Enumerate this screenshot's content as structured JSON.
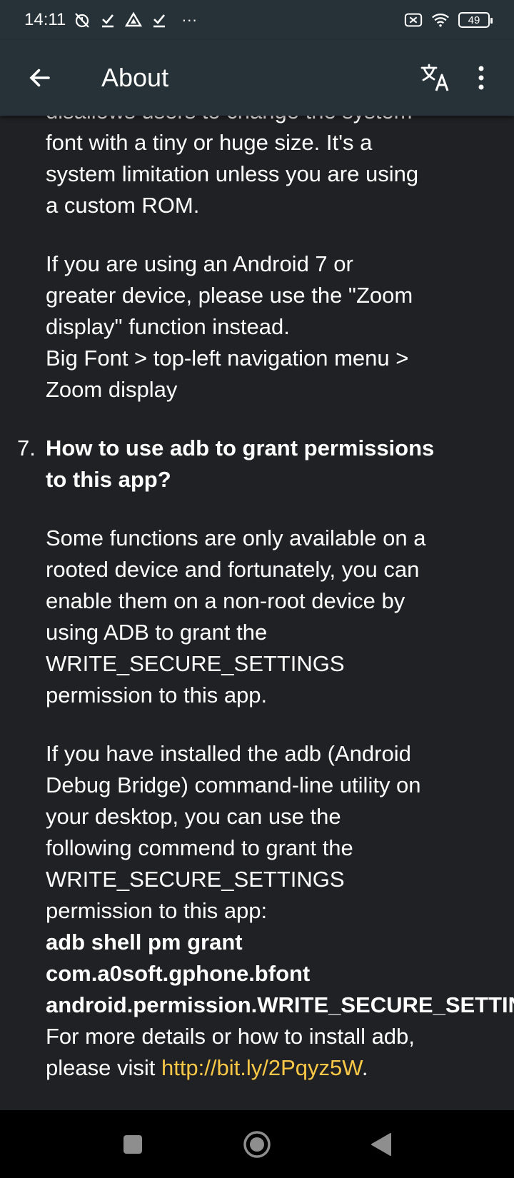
{
  "status_bar": {
    "time": "14:11",
    "more": "···",
    "battery": "49"
  },
  "app_bar": {
    "title": "About"
  },
  "content": {
    "partial_top_line": "disallows users to change the system",
    "p1_lines": [
      "font with a tiny or huge size. It's a",
      "system limitation unless you are using",
      "a custom ROM."
    ],
    "p2_lines": [
      "If you are using an Android 7 or",
      "greater device, please use the \"Zoom",
      "display\" function instead.",
      "Big Font > top-left navigation menu >",
      "Zoom display"
    ],
    "question": {
      "number": "7.",
      "lines": [
        "How to use adb to grant permissions",
        "to this app?"
      ]
    },
    "p3_lines": [
      "Some functions are only available on a",
      "rooted device and fortunately, you can",
      "enable them on a non-root device by",
      "using ADB to grant the",
      "WRITE_SECURE_SETTINGS",
      "permission to this app."
    ],
    "p4_lines": [
      "If you have installed the adb (Android",
      "Debug Bridge) command-line utility on",
      "your desktop, you can use the",
      "following commend to grant the",
      "WRITE_SECURE_SETTINGS",
      "permission to this app:"
    ],
    "command_lines": [
      "adb shell pm grant",
      "com.a0soft.gphone.bfont",
      "android.permission.WRITE_SECURE_SETTINGS"
    ],
    "details_line": "For more details or how to install adb,",
    "visit_prefix": "please visit ",
    "link_text": "http://bit.ly/2Pqyz5W",
    "visit_suffix": "."
  },
  "colors": {
    "app_bar_bg": "#263238",
    "content_bg": "#202124",
    "link": "#f9c846",
    "nav_bg": "#000000"
  },
  "icons": {
    "back": "arrow-left-icon",
    "translate": "translate-icon",
    "overflow": "more-vert-icon",
    "nav_recents": "square-icon",
    "nav_home": "circle-icon",
    "nav_back": "triangle-back-icon"
  }
}
